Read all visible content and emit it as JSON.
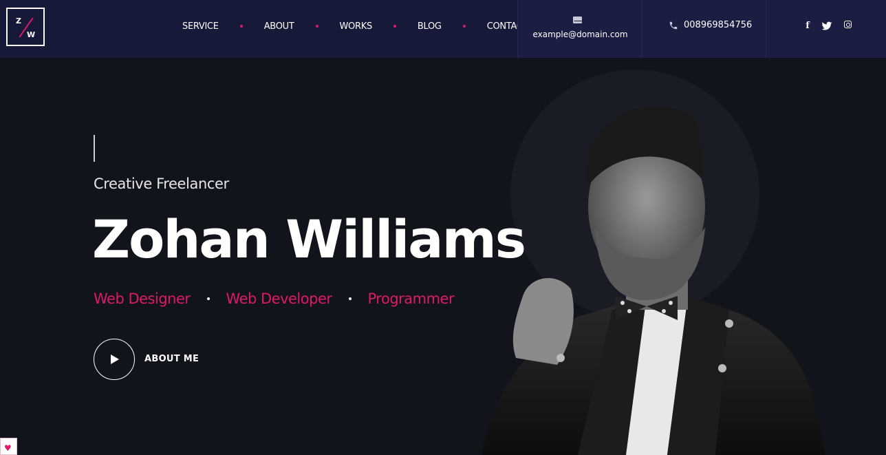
{
  "logo": {
    "top": "Z",
    "bottom": "W"
  },
  "nav": {
    "items": [
      {
        "label": "SERVICE"
      },
      {
        "label": "ABOUT"
      },
      {
        "label": "WORKS"
      },
      {
        "label": "BLOG"
      },
      {
        "label": "CONTACT"
      }
    ]
  },
  "contact": {
    "email": "example@domain.com",
    "phone": "008969854756",
    "mail_icon": "envelope-icon",
    "phone_icon": "phone-icon"
  },
  "social": {
    "facebook": "f",
    "twitter": "twitter-icon",
    "instagram": "instagram-icon"
  },
  "hero": {
    "subtitle": "Creative Freelancer",
    "name": "Zohan Williams",
    "roles": [
      "Web Designer",
      "Web Developer",
      "Programmer"
    ],
    "about_label": "ABOUT ME"
  },
  "colors": {
    "accent": "#e0186b",
    "header_bg": "#171938",
    "hero_bg": "#12141c"
  }
}
